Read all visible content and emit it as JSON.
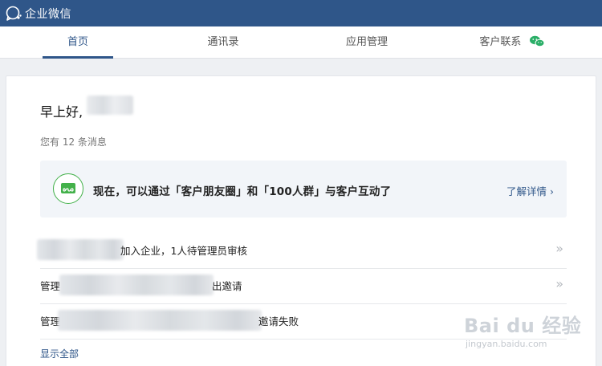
{
  "app": {
    "title": "企业微信"
  },
  "tabs": [
    {
      "label": "首页",
      "active": true
    },
    {
      "label": "通讯录",
      "active": false
    },
    {
      "label": "应用管理",
      "active": false
    },
    {
      "label": "客户联系",
      "active": false,
      "icon": "wechat-icon"
    }
  ],
  "home": {
    "greeting": "早上好,",
    "message_count": "您有 12 条消息",
    "banner": {
      "text": "现在，可以通过「客户朋友圈」和「100人群」与客户互动了",
      "link": "了解详情 ›"
    },
    "notifications": [
      {
        "text": "加入企业，1人待管理员审核",
        "chevron": "»"
      },
      {
        "text_left": "管理",
        "text_right": "出邀请",
        "chevron": "»"
      },
      {
        "text_left": "管理",
        "text_right": "邀请失败",
        "chevron": ""
      }
    ],
    "show_all": "显示全部"
  },
  "watermark": {
    "main": "Bai du 经验",
    "sub": "jingyan.baidu.com"
  },
  "colors": {
    "topbar": "#2f5689",
    "accent": "#2f5689",
    "banner_icon": "#43b14a",
    "wechat_green": "#2aae67"
  }
}
